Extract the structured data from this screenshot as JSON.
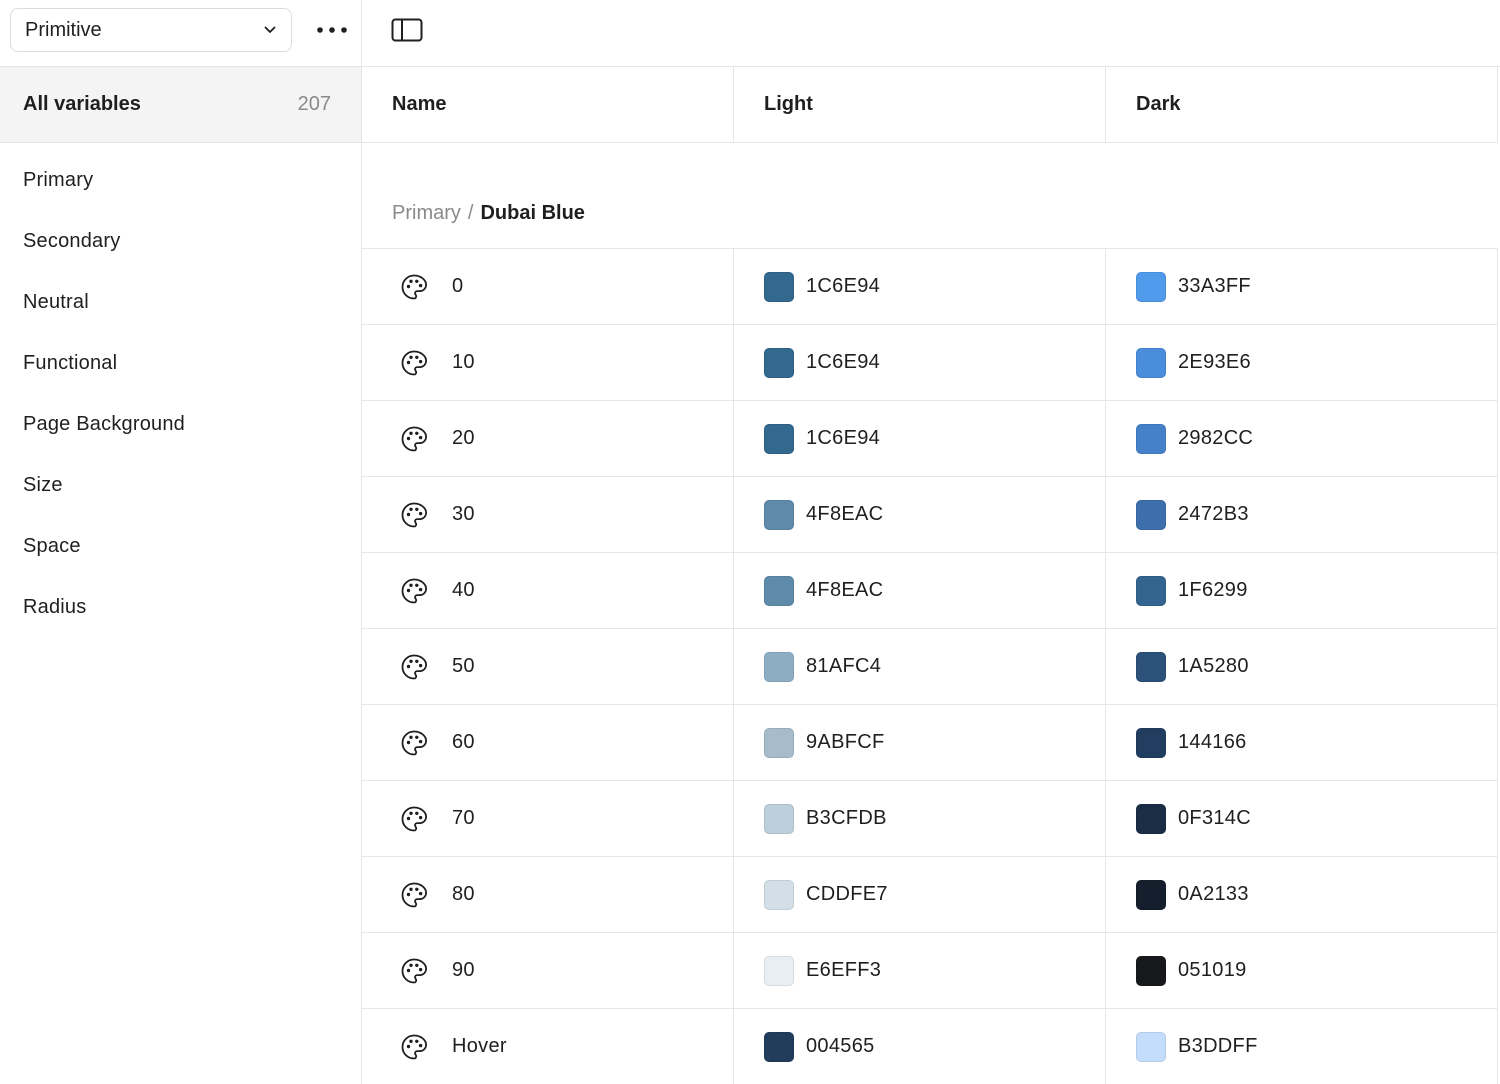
{
  "sidebar": {
    "collection": {
      "value": "Primitive"
    },
    "all_variables": {
      "label": "All variables",
      "count": "207"
    },
    "groups": [
      {
        "label": "Primary"
      },
      {
        "label": "Secondary"
      },
      {
        "label": "Neutral"
      },
      {
        "label": "Functional"
      },
      {
        "label": "Page Background"
      },
      {
        "label": "Size"
      },
      {
        "label": "Space"
      },
      {
        "label": "Radius"
      }
    ]
  },
  "table": {
    "columns": {
      "name": "Name",
      "light": "Light",
      "dark": "Dark"
    },
    "group_path": {
      "parent": "Primary",
      "separator": "/",
      "current": "Dubai Blue"
    },
    "rows": [
      {
        "name": "0",
        "light": {
          "hex": "1C6E94",
          "swatch": "#33698F"
        },
        "dark": {
          "hex": "33A3FF",
          "swatch": "#4F9AEB"
        }
      },
      {
        "name": "10",
        "light": {
          "hex": "1C6E94",
          "swatch": "#33698F"
        },
        "dark": {
          "hex": "2E93E6",
          "swatch": "#4A8DDC"
        }
      },
      {
        "name": "20",
        "light": {
          "hex": "1C6E94",
          "swatch": "#33698F"
        },
        "dark": {
          "hex": "2982CC",
          "swatch": "#4481C8"
        }
      },
      {
        "name": "30",
        "light": {
          "hex": "4F8EAC",
          "swatch": "#5E8BAA"
        },
        "dark": {
          "hex": "2472B3",
          "swatch": "#3C6FAB"
        }
      },
      {
        "name": "40",
        "light": {
          "hex": "4F8EAC",
          "swatch": "#5E8BAA"
        },
        "dark": {
          "hex": "1F6299",
          "swatch": "#336490"
        }
      },
      {
        "name": "50",
        "light": {
          "hex": "81AFC4",
          "swatch": "#8CADC3"
        },
        "dark": {
          "hex": "1A5280",
          "swatch": "#2C5279"
        }
      },
      {
        "name": "60",
        "light": {
          "hex": "9ABFCF",
          "swatch": "#A6BCCB"
        },
        "dark": {
          "hex": "144166",
          "swatch": "#213E61"
        }
      },
      {
        "name": "70",
        "light": {
          "hex": "B3CFDB",
          "swatch": "#BCCFDA"
        },
        "dark": {
          "hex": "0F314C",
          "swatch": "#1A2D45"
        }
      },
      {
        "name": "80",
        "light": {
          "hex": "CDDFE7",
          "swatch": "#D2DFE6"
        },
        "dark": {
          "hex": "0A2133",
          "swatch": "#141E2C"
        }
      },
      {
        "name": "90",
        "light": {
          "hex": "E6EFF3",
          "swatch": "#E8EEF1"
        },
        "dark": {
          "hex": "051019",
          "swatch": "#17181B"
        }
      },
      {
        "name": "Hover",
        "light": {
          "hex": "004565",
          "swatch": "#223C5C"
        },
        "dark": {
          "hex": "B3DDFF",
          "swatch": "#C3DDFB"
        }
      }
    ]
  },
  "icons": {
    "collection_chevron": "chevron-down-icon",
    "more": "more-horizontal-icon",
    "panel_toggle": "sidebar-toggle-icon",
    "row_type": "palette-icon"
  }
}
